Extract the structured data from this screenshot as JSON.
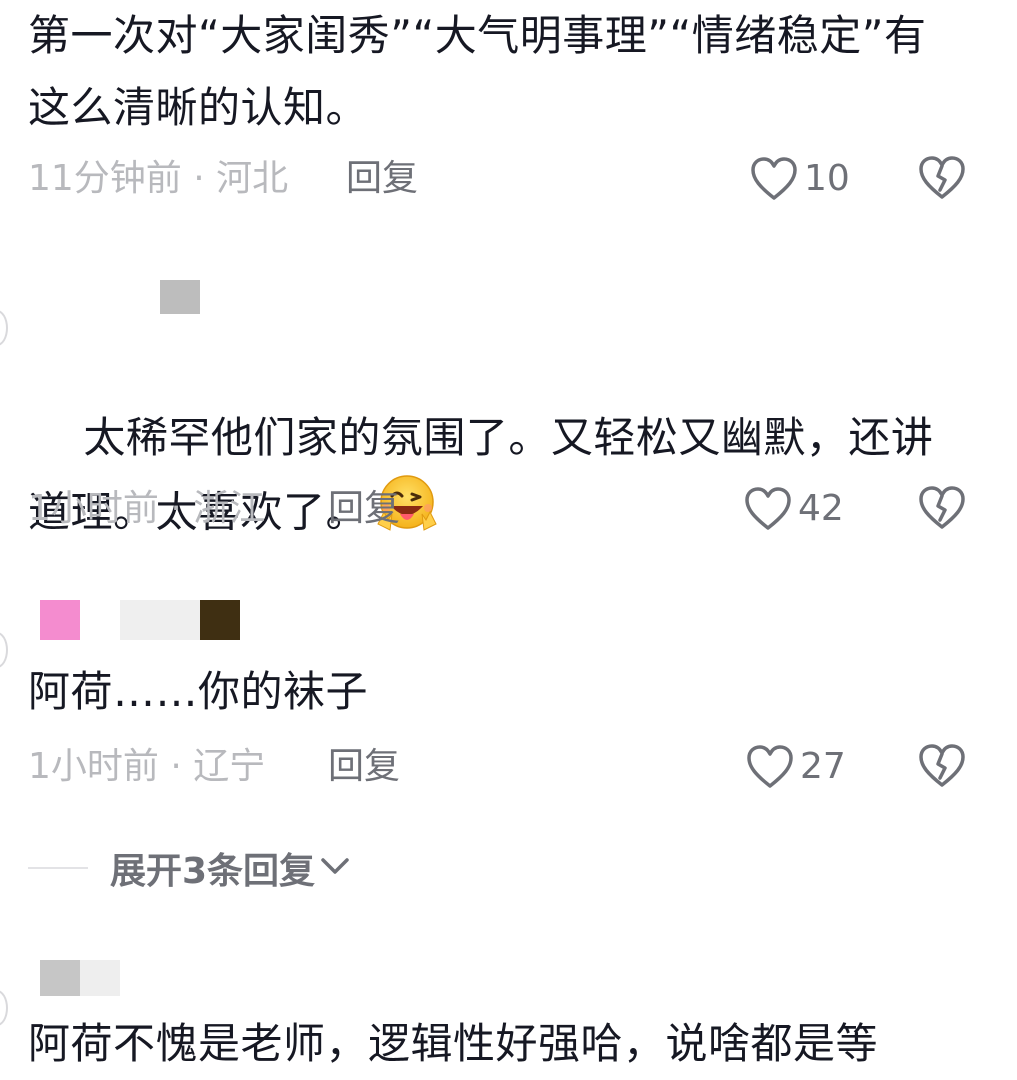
{
  "comments": [
    {
      "text": "第一次对“大家闺秀”“大气明事理”“情绪稳定”有这么清晰的认知。",
      "time_location": "11分钟前 · 河北",
      "reply_label": "回复",
      "likes": "10"
    },
    {
      "text": "太稀罕他们家的氛围了。又轻松又幽默，还讲道理。太喜欢了。",
      "emoji": "winking-face-with-tongue",
      "time_location": "1小时前 · 浙江",
      "reply_label": "回复",
      "likes": "42"
    },
    {
      "text": "阿荷……你的袜子",
      "time_location": "1小时前 · 辽宁",
      "reply_label": "回复",
      "likes": "27"
    },
    {
      "text": "阿荷不愧是老师，逻辑性好强哈，说啥都是等"
    }
  ],
  "expand_replies": {
    "label": "展开3条回复"
  },
  "colors": {
    "text": "#161823",
    "meta_gray": "#b8b9bd",
    "action_gray": "#6e7077",
    "redaction_pink": "#f48ccf",
    "redaction_brown": "#3f2f12",
    "redaction_gray": "#bdbdbd"
  }
}
